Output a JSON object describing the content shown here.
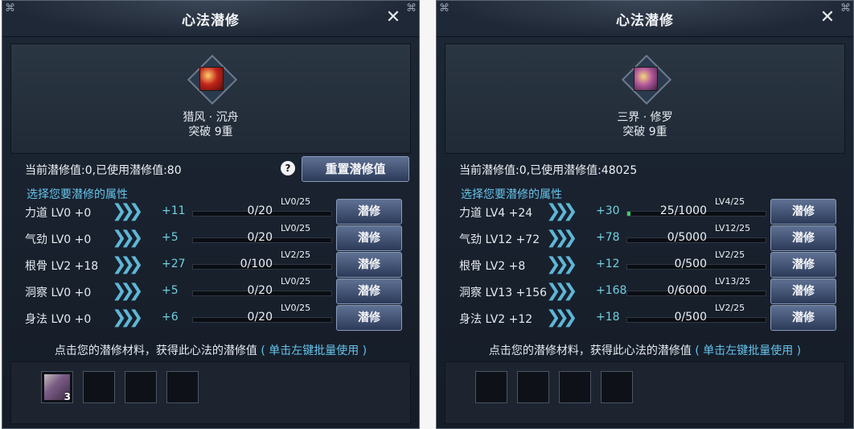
{
  "panels": [
    {
      "title": "心法潜修",
      "book": {
        "name": "猎风 · 沉舟",
        "breakthrough": "突破 9重",
        "icon": "red-book-icon"
      },
      "current_text": "当前潜修值:0,已使用潜修值:80",
      "help_label": "?",
      "reset_label": "重置潜修值",
      "attr_header": "选择您要潜修的属性",
      "rows": [
        {
          "name": "力道 LV0 +0",
          "gain": "+11",
          "progress": "0/20",
          "level": "LV0/25",
          "fill": 0,
          "btn": "潜修"
        },
        {
          "name": "气劲 LV0 +0",
          "gain": "+5",
          "progress": "0/20",
          "level": "LV0/25",
          "fill": 0,
          "btn": "潜修"
        },
        {
          "name": "根骨 LV2 +18",
          "gain": "+27",
          "progress": "0/100",
          "level": "LV2/25",
          "fill": 0,
          "btn": "潜修"
        },
        {
          "name": "洞察 LV0 +0",
          "gain": "+5",
          "progress": "0/20",
          "level": "LV0/25",
          "fill": 0,
          "btn": "潜修"
        },
        {
          "name": "身法 LV0 +0",
          "gain": "+6",
          "progress": "0/20",
          "level": "LV0/25",
          "fill": 0,
          "btn": "潜修"
        }
      ],
      "hint": "点击您的潜修材料，获得此心法的潜修值",
      "hint_link": "( 单击左键批量使用 )",
      "slots": [
        {
          "count": "3",
          "filled": true
        },
        {
          "filled": false
        },
        {
          "filled": false
        },
        {
          "filled": false
        }
      ]
    },
    {
      "title": "心法潜修",
      "book": {
        "name": "三界 · 修罗",
        "breakthrough": "突破 9重",
        "icon": "purple-book-icon"
      },
      "current_text": "当前潜修值:0,已使用潜修值:48025",
      "attr_header": "选择您要潜修的属性",
      "rows": [
        {
          "name": "力道 LV4 +24",
          "gain": "+30",
          "progress": "25/1000",
          "level": "LV4/25",
          "fill": 0.025,
          "btn": "潜修"
        },
        {
          "name": "气劲 LV12 +72",
          "gain": "+78",
          "progress": "0/5000",
          "level": "LV12/25",
          "fill": 0,
          "btn": "潜修"
        },
        {
          "name": "根骨 LV2 +8",
          "gain": "+12",
          "progress": "0/500",
          "level": "LV2/25",
          "fill": 0,
          "btn": "潜修"
        },
        {
          "name": "洞察 LV13 +156",
          "gain": "+168",
          "progress": "0/6000",
          "level": "LV13/25",
          "fill": 0,
          "btn": "潜修"
        },
        {
          "name": "身法 LV2 +12",
          "gain": "+18",
          "progress": "0/500",
          "level": "LV2/25",
          "fill": 0,
          "btn": "潜修"
        }
      ],
      "hint": "点击您的潜修材料，获得此心法的潜修值",
      "hint_link": "( 单击左键批量使用 )",
      "slots": [
        {
          "filled": false
        },
        {
          "filled": false
        },
        {
          "filled": false
        },
        {
          "filled": false
        }
      ]
    }
  ],
  "close_icon": "close-icon",
  "arrow_icon": "triple-chevron-right-icon"
}
